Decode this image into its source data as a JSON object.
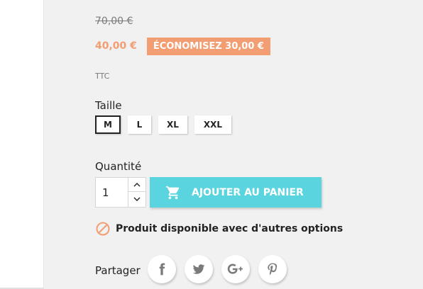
{
  "product": {
    "regular_price": "70,00 €",
    "price": "40,00 €",
    "discount": "ÉCONOMISEZ 30,00 €",
    "tax_label": "TTC"
  },
  "size_selector": {
    "label": "Taille",
    "options": [
      "M",
      "L",
      "XL",
      "XXL"
    ],
    "selected": "M"
  },
  "quantity": {
    "label": "Quantité",
    "value": "1"
  },
  "add_to_cart": {
    "label": "AJOUTER AU PANIER",
    "icon": "cart-icon"
  },
  "availability": {
    "message": "Produit disponible avec d'autres options",
    "icon": "ban-icon"
  },
  "share": {
    "label": "Partager",
    "networks": [
      "facebook",
      "twitter",
      "google-plus",
      "pinterest"
    ]
  },
  "colors": {
    "accent_price": "#f39d72",
    "cart_button": "#5ad4de",
    "availability_icon": "#f39d72"
  }
}
